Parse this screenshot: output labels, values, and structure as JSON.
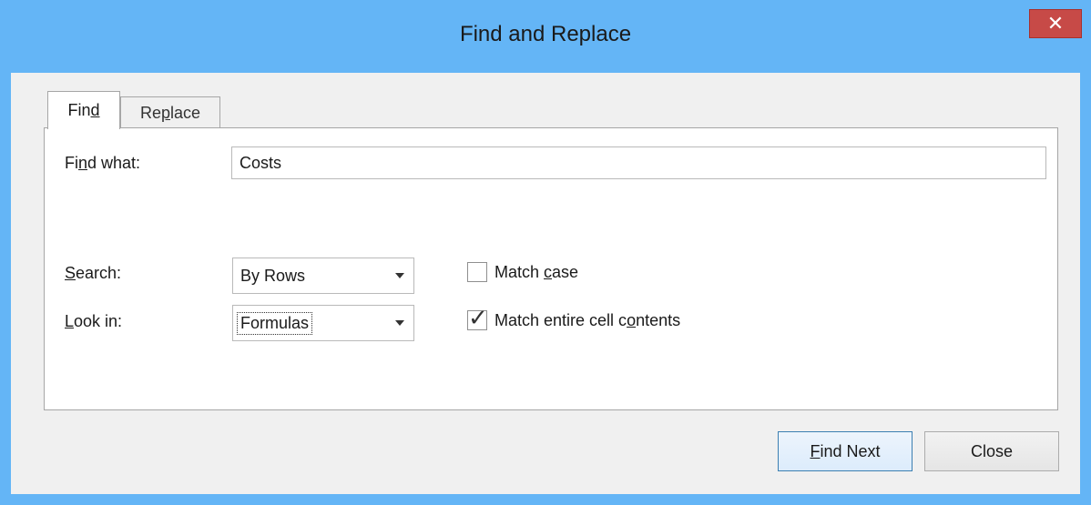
{
  "window": {
    "title": "Find and Replace",
    "close_glyph": "✕"
  },
  "tabs": [
    {
      "label_pre": "Fin",
      "label_accel": "d",
      "label_post": "",
      "active": true
    },
    {
      "label_pre": "Re",
      "label_accel": "p",
      "label_post": "lace",
      "active": false
    }
  ],
  "find_what": {
    "label_pre": "Fi",
    "label_accel": "n",
    "label_post": "d what:",
    "value": "Costs"
  },
  "search": {
    "label_pre": "",
    "label_accel": "S",
    "label_post": "earch:",
    "selected": "By Rows"
  },
  "look_in": {
    "label_pre": "",
    "label_accel": "L",
    "label_post": "ook in:",
    "selected": "Formulas"
  },
  "match_case": {
    "label_pre": "Match ",
    "label_accel": "c",
    "label_post": "ase",
    "checked": false
  },
  "match_entire": {
    "label_pre": "Match entire cell c",
    "label_accel": "o",
    "label_post": "ntents",
    "checked": true,
    "check_glyph": "✓"
  },
  "buttons": {
    "find_next": {
      "label_pre": "",
      "label_accel": "F",
      "label_post": "ind Next"
    },
    "close": {
      "label": "Close"
    }
  },
  "colors": {
    "frame": "#64b5f6",
    "close_button": "#c74a47",
    "dialog_bg": "#f0f0f0",
    "default_button_border": "#3c7fb1"
  }
}
